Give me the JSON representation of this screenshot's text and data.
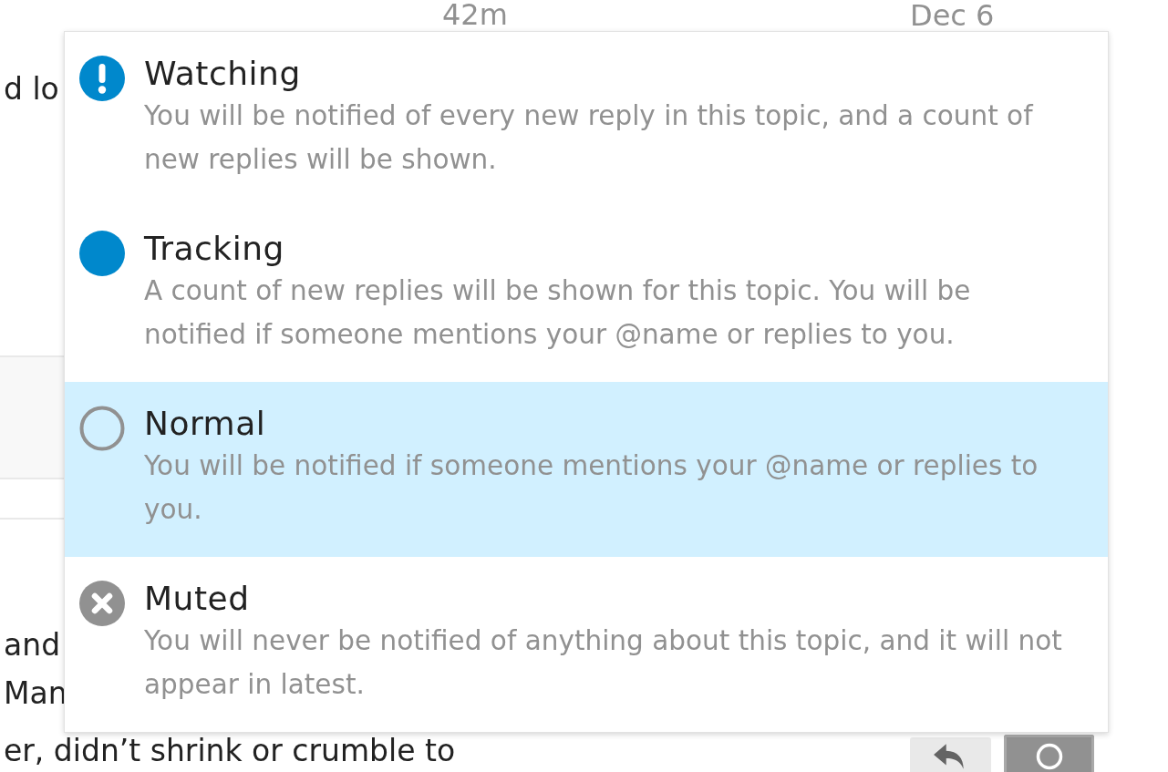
{
  "post_header": {
    "relative_time": "42m",
    "date": "Dec 6"
  },
  "intro_line": "d lo",
  "body_lines": [
    "and",
    "Man",
    "er, didn’t shrink or crumble to"
  ],
  "post_actions": [
    {
      "kind": "reply",
      "active": false
    },
    {
      "kind": "notification",
      "active": true
    }
  ],
  "notification_menu": {
    "options": [
      {
        "kind": "exclamation",
        "title": "Watching",
        "description": "You will be notified of every new reply in this topic, and a count of new replies will be shown.",
        "selected": false
      },
      {
        "kind": "dot",
        "title": "Tracking",
        "description": "A count of new replies will be shown for this topic. You will be notified if someone mentions your @name or replies to you.",
        "selected": false
      },
      {
        "kind": "ring",
        "title": "Normal",
        "description": "You will be notified if someone mentions your @name or replies to you.",
        "selected": true
      },
      {
        "kind": "cross",
        "title": "Muted",
        "description": "You will never be notified of anything about this topic, and it will not appear in latest.",
        "selected": false
      }
    ]
  }
}
